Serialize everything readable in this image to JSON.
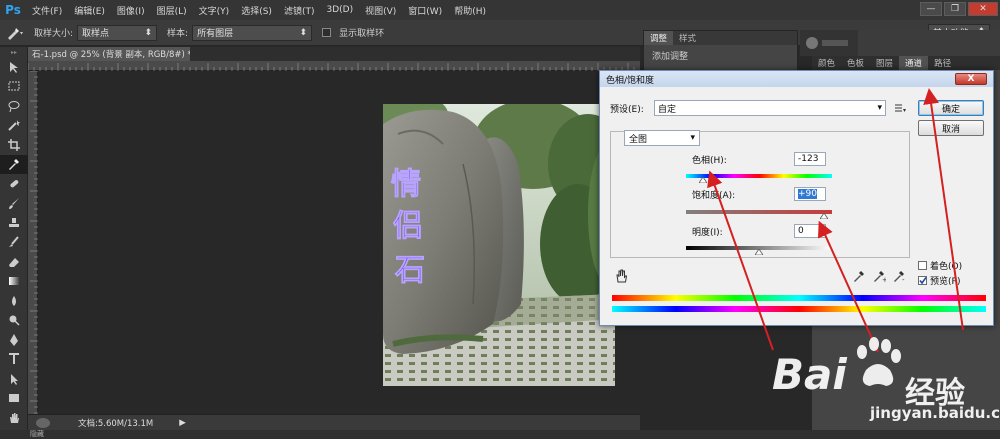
{
  "app": {
    "logo": "Ps",
    "menu": [
      "文件(F)",
      "编辑(E)",
      "图像(I)",
      "图层(L)",
      "文字(Y)",
      "选择(S)",
      "滤镜(T)",
      "3D(D)",
      "视图(V)",
      "窗口(W)",
      "帮助(H)"
    ],
    "window_controls": [
      "—",
      "❐",
      "✕"
    ]
  },
  "options": {
    "sample_size_label": "取样大小:",
    "sample_size_value": "取样点",
    "sample_label": "样本:",
    "sample_value": "所有图层",
    "show_ring_label": "显示取样环",
    "workspace": "基本功能"
  },
  "document": {
    "tab_title": "石-1.psd @ 25% (背景 副本, RGB/8#) *",
    "tab_close": "×",
    "status": "文档:5.60M/13.1M",
    "bottom": "隐藏"
  },
  "panels": {
    "adjust_tabs": [
      "调整",
      "样式"
    ],
    "adjust_title": "添加调整",
    "right_tabs": [
      "颜色",
      "色板",
      "图层",
      "通道",
      "路径"
    ]
  },
  "dialog": {
    "title": "色相/饱和度",
    "close": "X",
    "preset_label": "预设(E):",
    "preset_value": "自定",
    "channel_value": "全图",
    "hue_label": "色相(H):",
    "hue_value": "-123",
    "saturation_label": "饱和度(A):",
    "saturation_value": "+90",
    "lightness_label": "明度(I):",
    "lightness_value": "0",
    "ok_label": "确定",
    "cancel_label": "取消",
    "colorize_label": "着色(O)",
    "preview_label": "预览(P)",
    "colorize_checked": false,
    "preview_checked": true
  },
  "watermark": {
    "brand": "Bai",
    "brand_suffix": "经验",
    "url": "jingyan.baidu.com"
  },
  "colors": {
    "accent_arrow": "#d42020",
    "dialog_title": "#c4d5ec",
    "ok_border": "#3c7fb1"
  }
}
